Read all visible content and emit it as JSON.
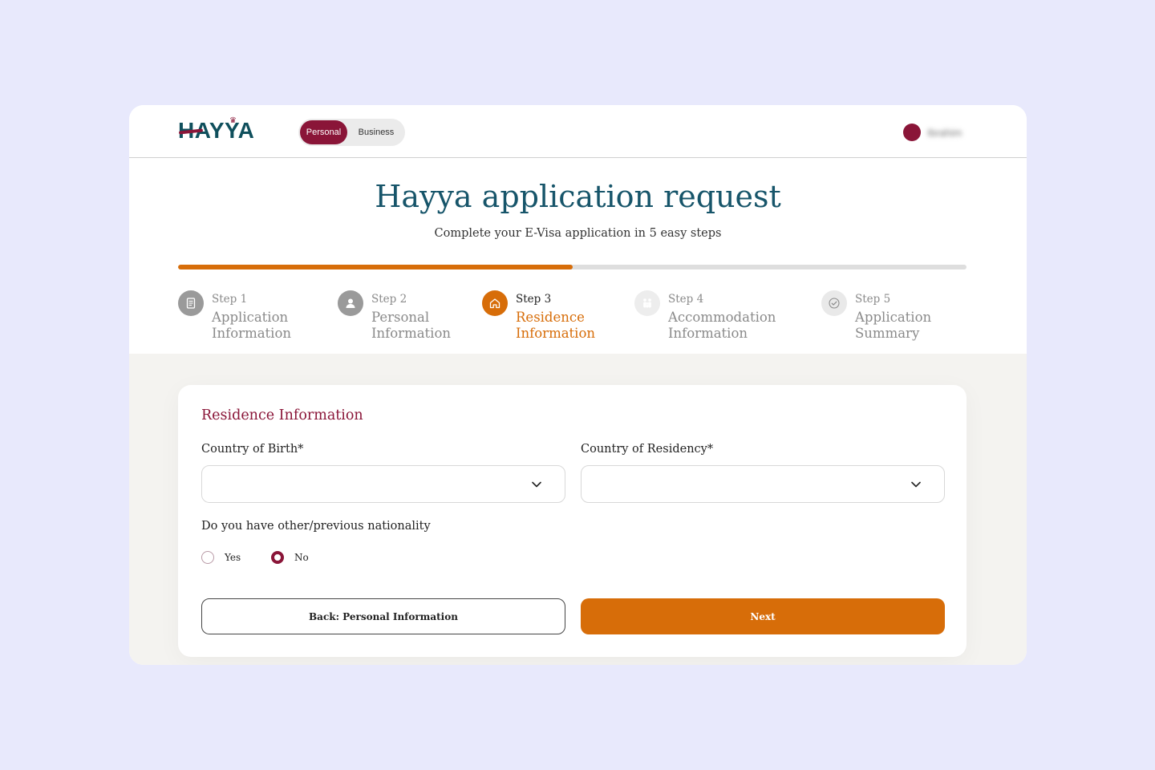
{
  "brand": {
    "logo_text": "HAYYA"
  },
  "header": {
    "toggle": {
      "personal": "Personal",
      "business": "Business"
    },
    "user": {
      "name": "Ibrahim"
    }
  },
  "page": {
    "title": "Hayya application request",
    "subtitle": "Complete your E-Visa application in 5 easy steps"
  },
  "progress": {
    "fraction": 0.5
  },
  "steps": [
    {
      "num": "Step 1",
      "line1": "Application",
      "line2": "Information",
      "icon": "document-icon"
    },
    {
      "num": "Step 2",
      "line1": "Personal",
      "line2": "Information",
      "icon": "user-icon"
    },
    {
      "num": "Step 3",
      "line1": "Residence",
      "line2": "Information",
      "icon": "home-icon",
      "active": true
    },
    {
      "num": "Step 4",
      "line1": "Accommodation",
      "line2": "Information",
      "icon": "family-icon"
    },
    {
      "num": "Step 5",
      "line1": "Application",
      "line2": "Summary",
      "icon": "check-circle-icon"
    }
  ],
  "form": {
    "section_title": "Residence Information",
    "country_of_birth": {
      "label": "Country of Birth*",
      "value": ""
    },
    "country_of_residency": {
      "label": "Country of Residency*",
      "value": ""
    },
    "nationality_question": "Do you have other/previous nationality",
    "options": {
      "yes": "Yes",
      "no": "No",
      "selected": "No"
    },
    "back_button": "Back: Personal Information",
    "next_button": "Next"
  },
  "colors": {
    "accent": "#d76d09",
    "brand": "#8a1538",
    "title": "#17556a"
  }
}
